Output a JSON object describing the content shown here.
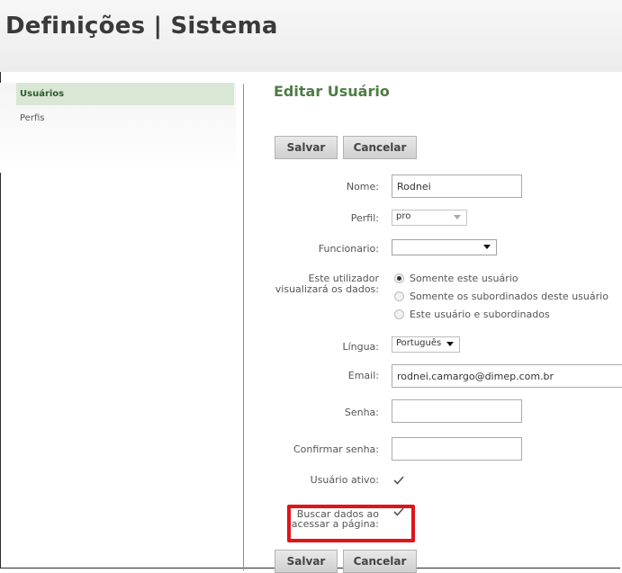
{
  "header": {
    "title": "Definições | Sistema"
  },
  "sidebar": {
    "items": [
      {
        "label": "Usuários",
        "active": true
      },
      {
        "label": "Perfis",
        "active": false
      }
    ]
  },
  "main": {
    "section_title": "Editar Usuário",
    "buttons": {
      "save": "Salvar",
      "cancel": "Cancelar"
    },
    "form": {
      "name": {
        "label": "Nome:",
        "value": "Rodnei"
      },
      "profile": {
        "label": "Perfil:",
        "value": "pro"
      },
      "employee": {
        "label": "Funcionario:",
        "value": ""
      },
      "data_visibility": {
        "label_line1": "Este utilizador",
        "label_line2": "visualizará os dados:",
        "options": [
          {
            "label": "Somente este usuário",
            "selected": true
          },
          {
            "label": "Somente os subordinados deste usuário",
            "selected": false
          },
          {
            "label": "Este usuário e subordinados",
            "selected": false
          }
        ]
      },
      "language": {
        "label": "Língua:",
        "value": "Português"
      },
      "email": {
        "label": "Email:",
        "value": "rodnei.camargo@dimep.com.br"
      },
      "password": {
        "label": "Senha:",
        "value": ""
      },
      "confirm_password": {
        "label": "Confirmar senha:",
        "value": ""
      },
      "active_user": {
        "label": "Usuário ativo:",
        "checked": true
      },
      "fetch_on_load": {
        "label_line1": "Buscar dados ao",
        "label_line2": "acessar a página:",
        "checked": true
      }
    }
  },
  "colors": {
    "accent_green": "#4e7d45",
    "sidebar_active_bg": "#d9e7d5",
    "highlight_red": "#e0141b"
  },
  "icons": {
    "select_arrow": "chevron-down-icon",
    "checkbox": "checkmark-icon"
  }
}
